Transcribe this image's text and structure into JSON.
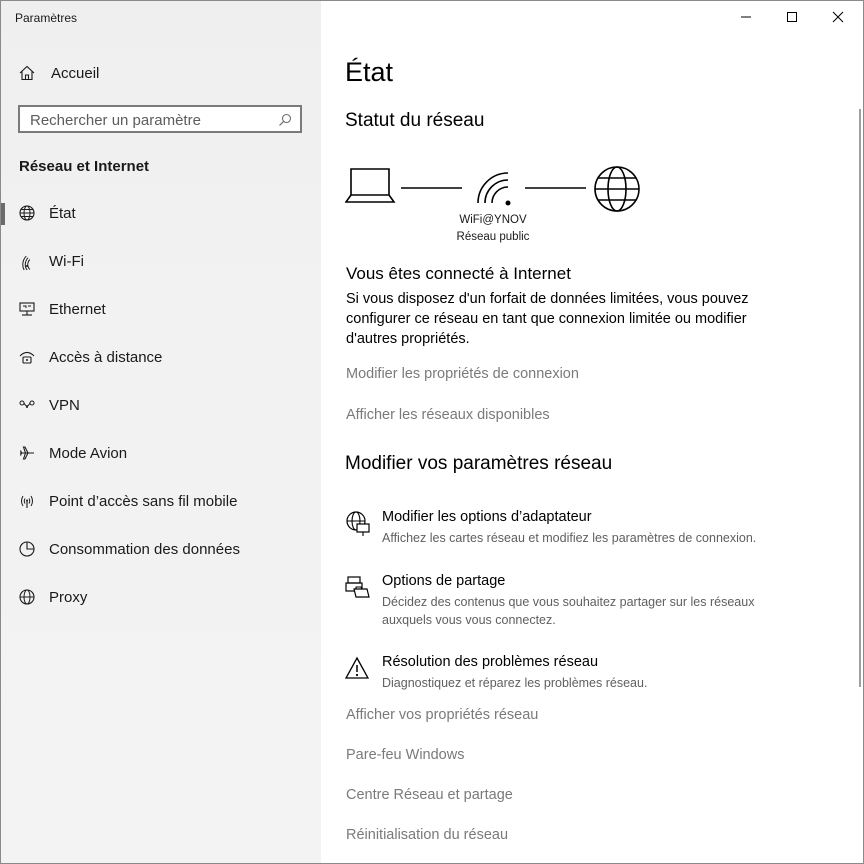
{
  "window": {
    "title": "Paramètres"
  },
  "sidebar": {
    "home_label": "Accueil",
    "search_placeholder": "Rechercher un paramètre",
    "section_title": "Réseau et Internet",
    "items": [
      {
        "label": "État",
        "icon": "globe-icon",
        "selected": true
      },
      {
        "label": "Wi-Fi",
        "icon": "wifi-icon"
      },
      {
        "label": "Ethernet",
        "icon": "ethernet-icon"
      },
      {
        "label": "Accès à distance",
        "icon": "dialup-icon"
      },
      {
        "label": "VPN",
        "icon": "vpn-icon"
      },
      {
        "label": "Mode Avion",
        "icon": "airplane-icon"
      },
      {
        "label": "Point d’accès sans fil mobile",
        "icon": "hotspot-icon"
      },
      {
        "label": "Consommation des données",
        "icon": "data-usage-icon"
      },
      {
        "label": "Proxy",
        "icon": "globe-icon"
      }
    ]
  },
  "main": {
    "page_title": "État",
    "network_status_title": "Statut du réseau",
    "network_name": "WiFi@YNOV",
    "network_profile": "Réseau public",
    "connected_title": "Vous êtes connecté à Internet",
    "connected_desc": "Si vous disposez d'un forfait de données limitées, vous pouvez configurer ce réseau en tant que connexion limitée ou modifier d'autres propriétés.",
    "link_properties": "Modifier les propriétés de connexion",
    "link_networks": "Afficher les réseaux disponibles",
    "change_settings_title": "Modifier vos paramètres réseau",
    "options": [
      {
        "title": "Modifier les options d’adaptateur",
        "desc": "Affichez les cartes réseau et modifiez les paramètres de connexion.",
        "icon": "adapter-icon"
      },
      {
        "title": "Options de partage",
        "desc": "Décidez des contenus que vous souhaitez partager sur les réseaux auxquels vous vous connectez.",
        "icon": "sharing-icon"
      },
      {
        "title": "Résolution des problèmes réseau",
        "desc": "Diagnostiquez et réparez les problèmes réseau.",
        "icon": "warning-icon"
      }
    ],
    "bottom_links": [
      "Afficher vos propriétés réseau",
      "Pare-feu Windows",
      "Centre Réseau et partage",
      "Réinitialisation du réseau"
    ]
  }
}
